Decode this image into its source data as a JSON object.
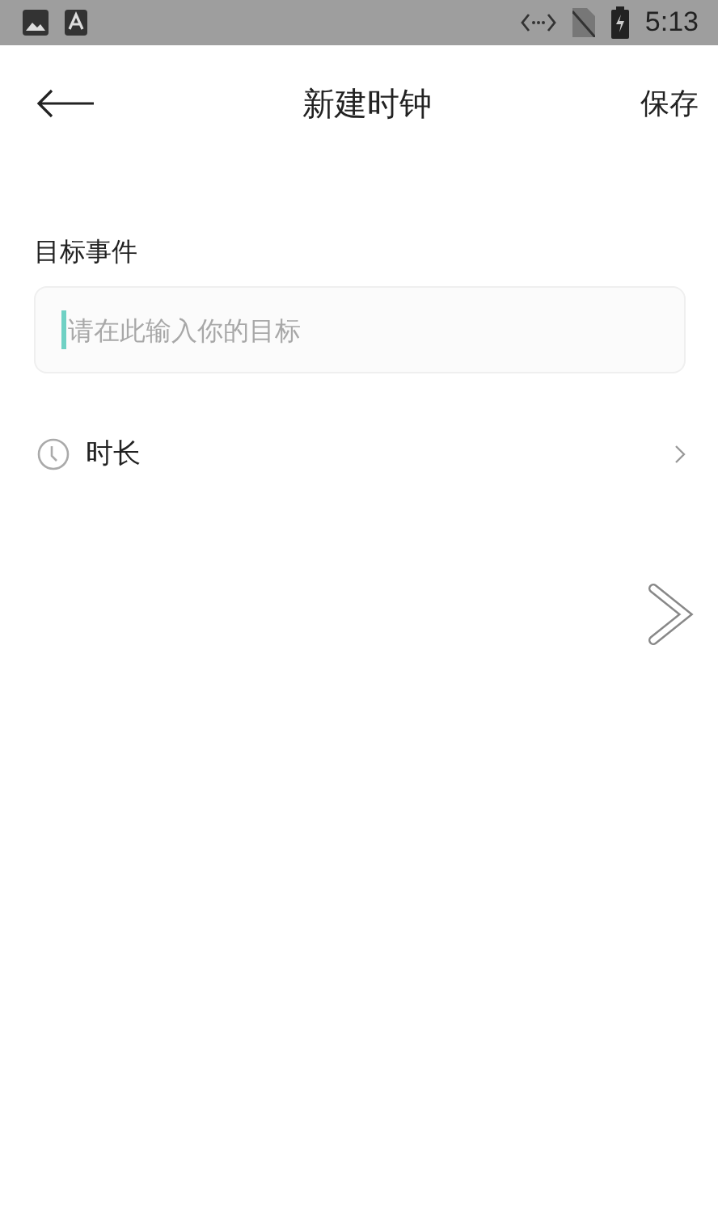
{
  "status_bar": {
    "time": "5:13"
  },
  "header": {
    "title": "新建时钟",
    "action": "保存"
  },
  "goal": {
    "label": "目标事件",
    "placeholder": "请在此输入你的目标"
  },
  "duration": {
    "label": "时长"
  }
}
